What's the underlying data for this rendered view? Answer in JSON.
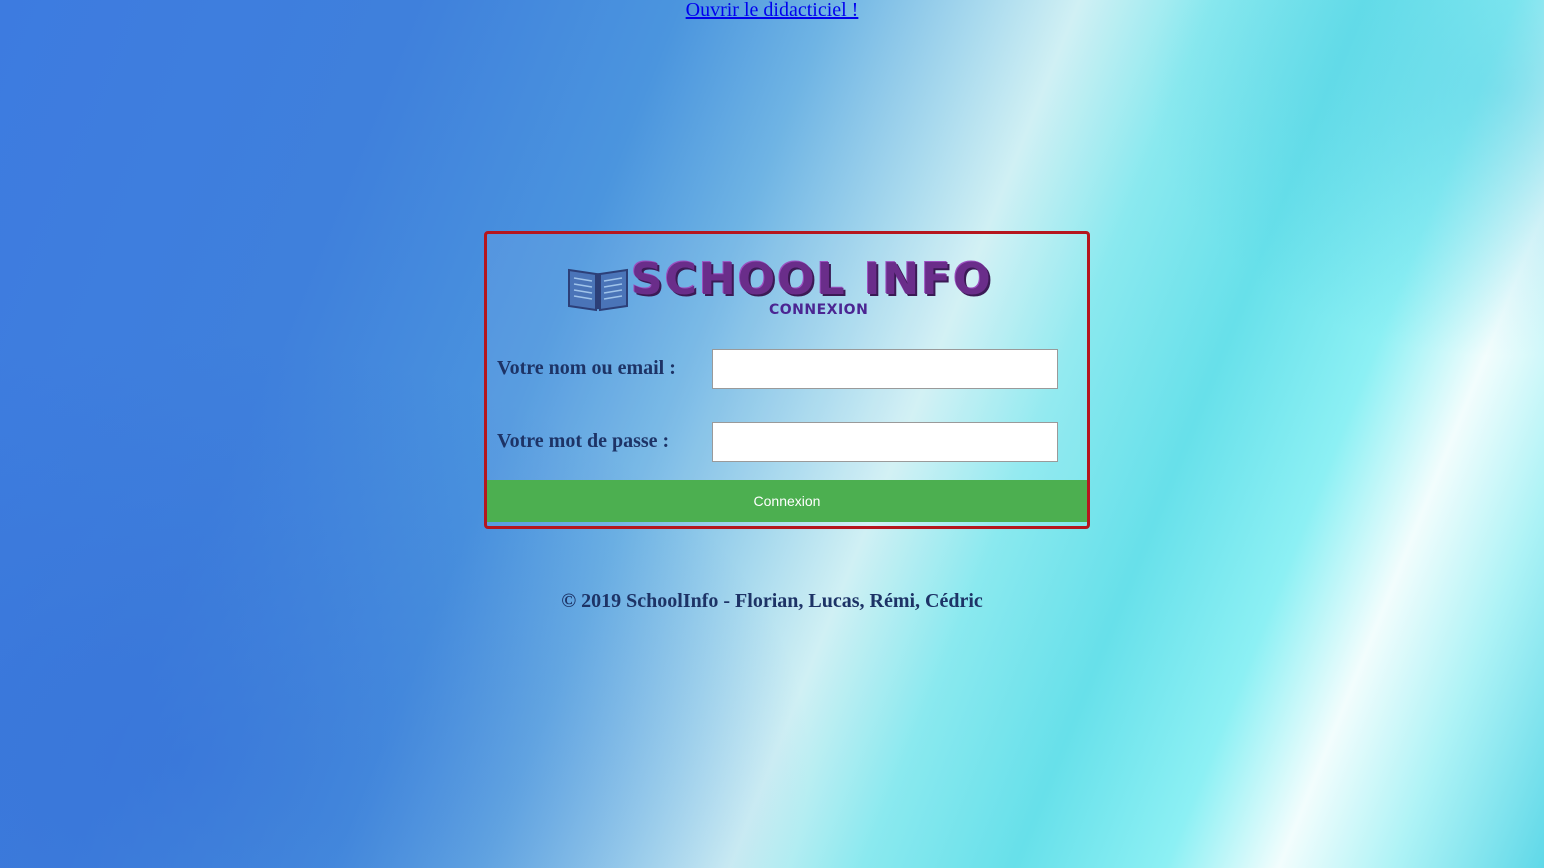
{
  "tutorial_link": {
    "label": "Ouvrir le didacticiel !"
  },
  "logo": {
    "title": "SCHOOL INFO",
    "subtitle": "CONNEXION",
    "icon": "open-book-icon"
  },
  "form": {
    "username_label": "Votre nom ou email :",
    "username_value": "",
    "username_placeholder": "",
    "password_label": "Votre mot de passe :",
    "password_value": "",
    "password_placeholder": "",
    "submit_label": "Connexion"
  },
  "footer": {
    "text": "© 2019 SchoolInfo - Florian, Lucas, Rémi, Cédric"
  },
  "colors": {
    "panel_border": "#b5161e",
    "button_bg": "#4caf50",
    "label_text": "#1d3366",
    "link": "#0000ee",
    "logo_purple": "#6a2d8a"
  }
}
